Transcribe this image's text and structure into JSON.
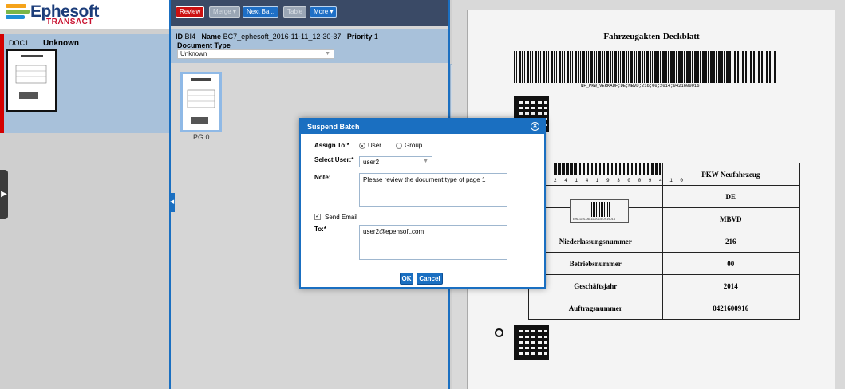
{
  "app": {
    "logo_name": "Ephesoft",
    "logo_sub": "TRANSACT",
    "colors": {
      "accent": "#1a6fc1",
      "toolbar": "#3a4a66",
      "review": "#cc1111"
    }
  },
  "sidebar": {
    "doc_id": "DOC1",
    "doc_type": "Unknown"
  },
  "toolbar": {
    "review_label": "Review",
    "merge_label": "Merge",
    "next_batch_label": "Next Ba...",
    "table_label": "Table",
    "more_label": "More"
  },
  "batch": {
    "id_label": "ID",
    "id": "BI4",
    "name_label": "Name",
    "name": "BC7_ephesoft_2016-11-11_12-30-37",
    "priority_label": "Priority",
    "priority": "1",
    "doctype_label": "Document Type",
    "doctype_value": "Unknown",
    "page_label": "PG 0"
  },
  "modal": {
    "title": "Suspend Batch",
    "assign_to_label": "Assign To:*",
    "option_user": "User",
    "option_group": "Group",
    "select_user_label": "Select User:*",
    "select_user_value": "user2",
    "note_label": "Note:",
    "note_value": "Please review the document type of page 1",
    "send_email_label": "Send Email",
    "to_label": "To:*",
    "to_value": "user2@epehsoft.com",
    "ok_label": "OK",
    "cancel_label": "Cancel"
  },
  "document": {
    "title": "Fahrzeugakten-Deckblatt",
    "barcode_text": "NF_PKW_VERKAUF;DE;MBVD;216;00;2014;0421600916",
    "digits": "2 4 1 4 1 9 3 0 0 9 4 1 0",
    "stamp_text": "Erst-DIS-06/11/2015-0919016",
    "table": [
      [
        "",
        "PKW Neufahrzeug"
      ],
      [
        "",
        "DE"
      ],
      [
        "",
        "MBVD"
      ],
      [
        "Niederlassungsnummer",
        "216"
      ],
      [
        "Betriebsnummer",
        "00"
      ],
      [
        "Geschäftsjahr",
        "2014"
      ],
      [
        "Auftragsnummer",
        "0421600916"
      ]
    ]
  }
}
